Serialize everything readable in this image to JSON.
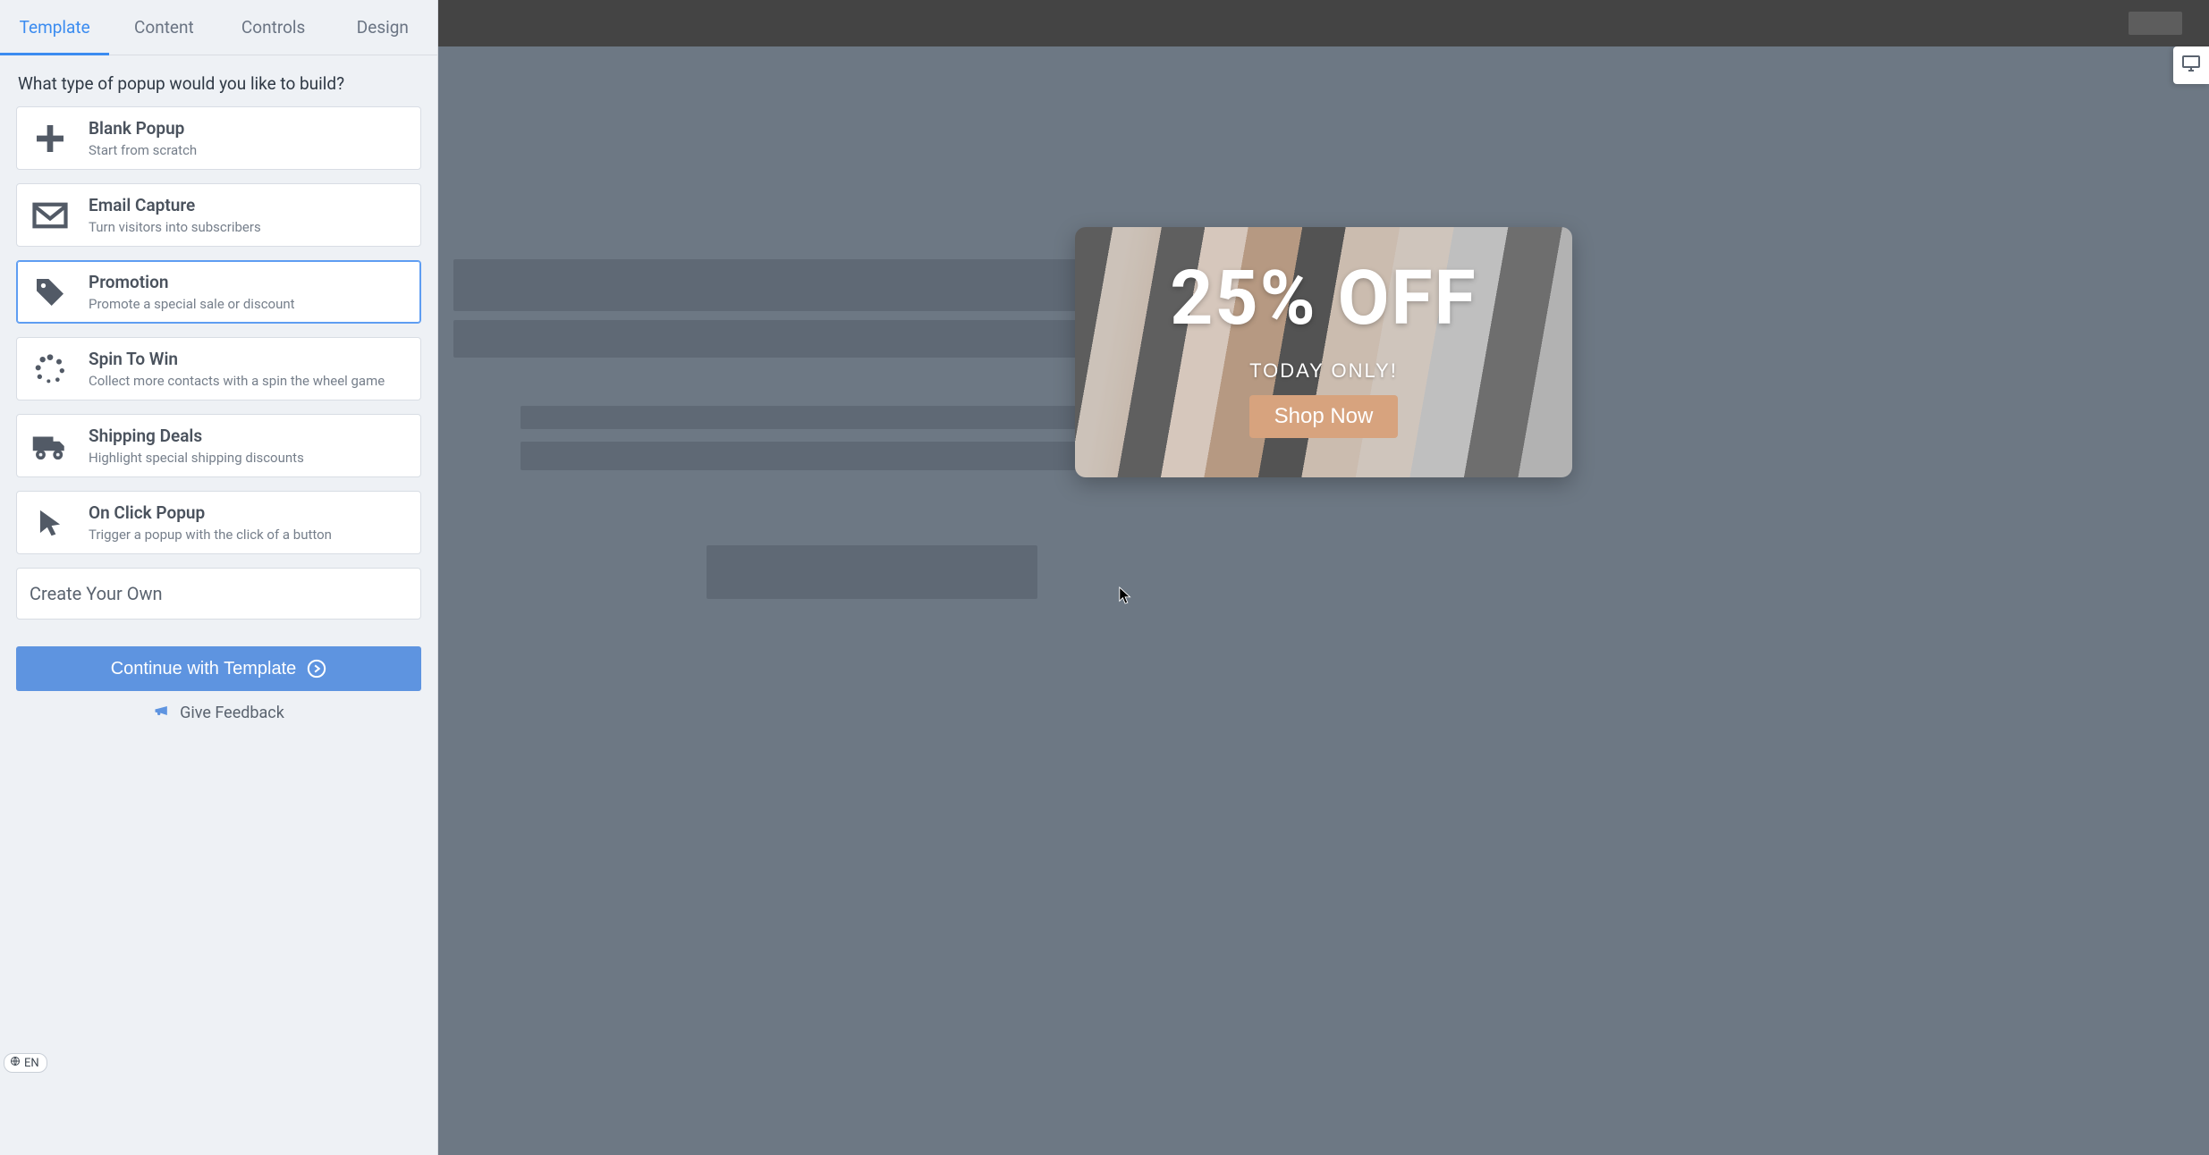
{
  "tabs": [
    "Template",
    "Content",
    "Controls",
    "Design"
  ],
  "active_tab_index": 0,
  "prompt": "What type of popup would you like to build?",
  "options": [
    {
      "key": "blank",
      "title": "Blank Popup",
      "desc": "Start from scratch"
    },
    {
      "key": "email",
      "title": "Email Capture",
      "desc": "Turn visitors into subscribers"
    },
    {
      "key": "promo",
      "title": "Promotion",
      "desc": "Promote a special sale or discount"
    },
    {
      "key": "spin",
      "title": "Spin To Win",
      "desc": "Collect more contacts with a spin the wheel game"
    },
    {
      "key": "shipping",
      "title": "Shipping Deals",
      "desc": "Highlight special shipping discounts"
    },
    {
      "key": "onclick",
      "title": "On Click Popup",
      "desc": "Trigger a popup with the click of a button"
    }
  ],
  "selected_option_key": "promo",
  "create_own_label": "Create Your Own",
  "continue_label": "Continue with Template",
  "feedback_label": "Give Feedback",
  "lang_label": "EN",
  "preview_popup": {
    "headline": "25% OFF",
    "subline": "TODAY ONLY!",
    "cta": "Shop Now"
  }
}
